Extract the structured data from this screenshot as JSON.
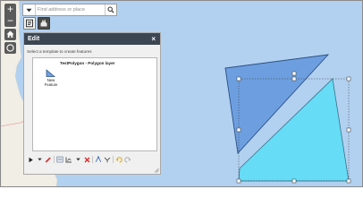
{
  "map": {
    "zoom_in_label": "+",
    "zoom_out_label": "−",
    "background_color": "#b2d1f1",
    "land_color": "#f1eee6",
    "polygon_colors": {
      "top_shape": "#6d9fe0",
      "bottom_shape": "#66dcf6"
    }
  },
  "search": {
    "placeholder": "Find address or place"
  },
  "edit_panel": {
    "title": "Edit",
    "close_label": "×",
    "hint": "Select a template to create features",
    "layer_name": "TestPolygon - Polygon layer",
    "template_label_line1": "New",
    "template_label_line2": "Feature"
  },
  "toolbar_icons": [
    "select-arrow-icon",
    "dropdown-icon",
    "pen-icon",
    "attributes-icon",
    "cut-icon",
    "delete-icon",
    "reshape-icon",
    "union-icon",
    "undo-icon",
    "redo-icon"
  ]
}
